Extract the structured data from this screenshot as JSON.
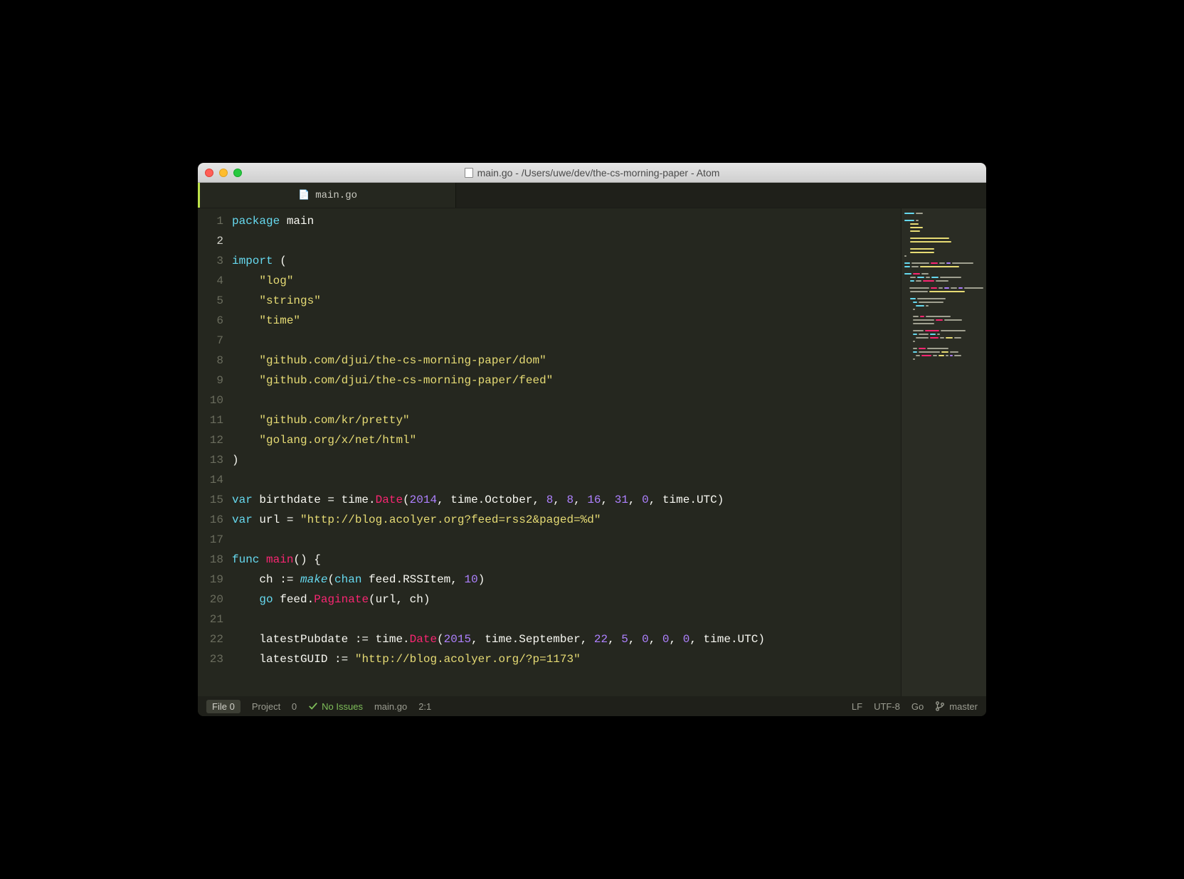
{
  "window": {
    "title": "main.go - /Users/uwe/dev/the-cs-morning-paper - Atom"
  },
  "tab": {
    "filename": "main.go",
    "icon": "file-code-icon",
    "modified": false
  },
  "editor": {
    "cursor_line": 2,
    "lines": [
      {
        "n": 1,
        "tokens": [
          {
            "t": "package ",
            "c": "kw"
          },
          {
            "t": "main",
            "c": "pkg"
          }
        ]
      },
      {
        "n": 2,
        "tokens": []
      },
      {
        "n": 3,
        "tokens": [
          {
            "t": "import ",
            "c": "kw"
          },
          {
            "t": "(",
            "c": "id"
          }
        ]
      },
      {
        "n": 4,
        "tokens": [
          {
            "t": "    ",
            "c": "id"
          },
          {
            "t": "\"log\"",
            "c": "str"
          }
        ]
      },
      {
        "n": 5,
        "tokens": [
          {
            "t": "    ",
            "c": "id"
          },
          {
            "t": "\"strings\"",
            "c": "str"
          }
        ]
      },
      {
        "n": 6,
        "tokens": [
          {
            "t": "    ",
            "c": "id"
          },
          {
            "t": "\"time\"",
            "c": "str"
          }
        ]
      },
      {
        "n": 7,
        "tokens": []
      },
      {
        "n": 8,
        "tokens": [
          {
            "t": "    ",
            "c": "id"
          },
          {
            "t": "\"github.com/djui/the-cs-morning-paper/dom\"",
            "c": "str"
          }
        ]
      },
      {
        "n": 9,
        "tokens": [
          {
            "t": "    ",
            "c": "id"
          },
          {
            "t": "\"github.com/djui/the-cs-morning-paper/feed\"",
            "c": "str"
          }
        ]
      },
      {
        "n": 10,
        "tokens": []
      },
      {
        "n": 11,
        "tokens": [
          {
            "t": "    ",
            "c": "id"
          },
          {
            "t": "\"github.com/kr/pretty\"",
            "c": "str"
          }
        ]
      },
      {
        "n": 12,
        "tokens": [
          {
            "t": "    ",
            "c": "id"
          },
          {
            "t": "\"golang.org/x/net/html\"",
            "c": "str"
          }
        ]
      },
      {
        "n": 13,
        "tokens": [
          {
            "t": ")",
            "c": "id"
          }
        ]
      },
      {
        "n": 14,
        "tokens": []
      },
      {
        "n": 15,
        "tokens": [
          {
            "t": "var ",
            "c": "kw"
          },
          {
            "t": "birthdate ",
            "c": "id"
          },
          {
            "t": "= ",
            "c": "id"
          },
          {
            "t": "time",
            "c": "id"
          },
          {
            "t": ".",
            "c": "id"
          },
          {
            "t": "Date",
            "c": "fn"
          },
          {
            "t": "(",
            "c": "id"
          },
          {
            "t": "2014",
            "c": "num"
          },
          {
            "t": ", time.October, ",
            "c": "id"
          },
          {
            "t": "8",
            "c": "num"
          },
          {
            "t": ", ",
            "c": "id"
          },
          {
            "t": "8",
            "c": "num"
          },
          {
            "t": ", ",
            "c": "id"
          },
          {
            "t": "16",
            "c": "num"
          },
          {
            "t": ", ",
            "c": "id"
          },
          {
            "t": "31",
            "c": "num"
          },
          {
            "t": ", ",
            "c": "id"
          },
          {
            "t": "0",
            "c": "num"
          },
          {
            "t": ", time.UTC)",
            "c": "id"
          }
        ]
      },
      {
        "n": 16,
        "tokens": [
          {
            "t": "var ",
            "c": "kw"
          },
          {
            "t": "url ",
            "c": "id"
          },
          {
            "t": "= ",
            "c": "id"
          },
          {
            "t": "\"http://blog.acolyer.org?feed=rss2&paged=%d\"",
            "c": "str"
          }
        ]
      },
      {
        "n": 17,
        "tokens": []
      },
      {
        "n": 18,
        "tokens": [
          {
            "t": "func ",
            "c": "kw"
          },
          {
            "t": "main",
            "c": "fn"
          },
          {
            "t": "() {",
            "c": "id"
          }
        ]
      },
      {
        "n": 19,
        "tokens": [
          {
            "t": "    ch ",
            "c": "id"
          },
          {
            "t": ":=",
            "c": "id"
          },
          {
            "t": " ",
            "c": "id"
          },
          {
            "t": "make",
            "c": "bi"
          },
          {
            "t": "(",
            "c": "id"
          },
          {
            "t": "chan ",
            "c": "kw"
          },
          {
            "t": "feed.RSSItem, ",
            "c": "id"
          },
          {
            "t": "10",
            "c": "num"
          },
          {
            "t": ")",
            "c": "id"
          }
        ]
      },
      {
        "n": 20,
        "tokens": [
          {
            "t": "    ",
            "c": "id"
          },
          {
            "t": "go ",
            "c": "kw"
          },
          {
            "t": "feed.",
            "c": "id"
          },
          {
            "t": "Paginate",
            "c": "fn"
          },
          {
            "t": "(url, ch)",
            "c": "id"
          }
        ]
      },
      {
        "n": 21,
        "tokens": []
      },
      {
        "n": 22,
        "tokens": [
          {
            "t": "    latestPubdate ",
            "c": "id"
          },
          {
            "t": ":=",
            "c": "id"
          },
          {
            "t": " time.",
            "c": "id"
          },
          {
            "t": "Date",
            "c": "fn"
          },
          {
            "t": "(",
            "c": "id"
          },
          {
            "t": "2015",
            "c": "num"
          },
          {
            "t": ", time.September, ",
            "c": "id"
          },
          {
            "t": "22",
            "c": "num"
          },
          {
            "t": ", ",
            "c": "id"
          },
          {
            "t": "5",
            "c": "num"
          },
          {
            "t": ", ",
            "c": "id"
          },
          {
            "t": "0",
            "c": "num"
          },
          {
            "t": ", ",
            "c": "id"
          },
          {
            "t": "0",
            "c": "num"
          },
          {
            "t": ", ",
            "c": "id"
          },
          {
            "t": "0",
            "c": "num"
          },
          {
            "t": ", time.UTC)",
            "c": "id"
          }
        ]
      },
      {
        "n": 23,
        "tokens": [
          {
            "t": "    latestGUID ",
            "c": "id"
          },
          {
            "t": ":=",
            "c": "id"
          },
          {
            "t": " ",
            "c": "id"
          },
          {
            "t": "\"http://blog.acolyer.org/?p=1173\"",
            "c": "str"
          }
        ]
      }
    ]
  },
  "statusbar": {
    "file_label": "File",
    "file_count": "0",
    "project_label": "Project",
    "project_count": "0",
    "issues": "No Issues",
    "path": "main.go",
    "cursor": "2:1",
    "eol": "LF",
    "encoding": "UTF-8",
    "language": "Go",
    "branch": "master"
  },
  "colors": {
    "minimap": [
      [
        [
          "#66d9ef",
          14
        ],
        [
          "#a0a090",
          10
        ]
      ],
      [],
      [
        [
          "#66d9ef",
          14
        ],
        [
          "#a0a090",
          4
        ]
      ],
      [
        [
          "",
          6
        ],
        [
          "#e6db74",
          12
        ]
      ],
      [
        [
          "",
          6
        ],
        [
          "#e6db74",
          18
        ]
      ],
      [
        [
          "",
          6
        ],
        [
          "#e6db74",
          14
        ]
      ],
      [],
      [
        [
          "",
          6
        ],
        [
          "#e6db74",
          55
        ]
      ],
      [
        [
          "",
          6
        ],
        [
          "#e6db74",
          58
        ]
      ],
      [],
      [
        [
          "",
          6
        ],
        [
          "#e6db74",
          34
        ]
      ],
      [
        [
          "",
          6
        ],
        [
          "#e6db74",
          34
        ]
      ],
      [
        [
          "#a0a090",
          3
        ]
      ],
      [],
      [
        [
          "#66d9ef",
          8
        ],
        [
          "#a0a090",
          25
        ],
        [
          "#f92672",
          10
        ],
        [
          "#a0a090",
          8
        ],
        [
          "#ae81ff",
          6
        ],
        [
          "#a0a090",
          30
        ]
      ],
      [
        [
          "#66d9ef",
          8
        ],
        [
          "#a0a090",
          10
        ],
        [
          "#e6db74",
          55
        ]
      ],
      [],
      [
        [
          "#66d9ef",
          10
        ],
        [
          "#f92672",
          10
        ],
        [
          "#a0a090",
          10
        ]
      ],
      [
        [
          "",
          6
        ],
        [
          "#a0a090",
          8
        ],
        [
          "#66d9ef",
          10
        ],
        [
          "#a0a090",
          6
        ],
        [
          "#66d9ef",
          10
        ],
        [
          "#a0a090",
          30
        ]
      ],
      [
        [
          "",
          6
        ],
        [
          "#66d9ef",
          6
        ],
        [
          "#a0a090",
          8
        ],
        [
          "#f92672",
          16
        ],
        [
          "#a0a090",
          18
        ]
      ],
      [],
      [
        [
          "",
          6
        ],
        [
          "#a0a090",
          30
        ],
        [
          "#f92672",
          10
        ],
        [
          "#a0a090",
          6
        ],
        [
          "#ae81ff",
          8
        ],
        [
          "#a0a090",
          10
        ],
        [
          "#ae81ff",
          6
        ],
        [
          "#a0a090",
          30
        ]
      ],
      [
        [
          "",
          6
        ],
        [
          "#a0a090",
          25
        ],
        [
          "#e6db74",
          50
        ]
      ],
      [],
      [
        [
          "",
          6
        ],
        [
          "#66d9ef",
          8
        ],
        [
          "#a0a090",
          40
        ]
      ],
      [
        [
          "",
          10
        ],
        [
          "#66d9ef",
          6
        ],
        [
          "#a0a090",
          35
        ]
      ],
      [
        [
          "",
          14
        ],
        [
          "#66d9ef",
          12
        ],
        [
          "#a0a090",
          4
        ]
      ],
      [
        [
          "",
          10
        ],
        [
          "#a0a090",
          3
        ]
      ],
      [],
      [
        [
          "",
          10
        ],
        [
          "#a0a090",
          8
        ],
        [
          "#f92672",
          6
        ],
        [
          "#a0a090",
          35
        ]
      ],
      [
        [
          "",
          10
        ],
        [
          "#a0a090",
          30
        ],
        [
          "#f92672",
          10
        ],
        [
          "#a0a090",
          25
        ]
      ],
      [
        [
          "",
          10
        ],
        [
          "#a0a090",
          30
        ]
      ],
      [],
      [
        [
          "",
          10
        ],
        [
          "#a0a090",
          15
        ],
        [
          "#f92672",
          20
        ],
        [
          "#a0a090",
          35
        ]
      ],
      [
        [
          "",
          10
        ],
        [
          "#66d9ef",
          6
        ],
        [
          "#a0a090",
          14
        ],
        [
          "#66d9ef",
          8
        ],
        [
          "#a0a090",
          4
        ]
      ],
      [
        [
          "",
          14
        ],
        [
          "#a0a090",
          18
        ],
        [
          "#f92672",
          12
        ],
        [
          "#a0a090",
          6
        ],
        [
          "#e6db74",
          10
        ],
        [
          "#a0a090",
          10
        ]
      ],
      [
        [
          "",
          10
        ],
        [
          "#a0a090",
          3
        ]
      ],
      [],
      [
        [
          "",
          10
        ],
        [
          "#a0a090",
          6
        ],
        [
          "#f92672",
          10
        ],
        [
          "#a0a090",
          30
        ]
      ],
      [
        [
          "",
          10
        ],
        [
          "#66d9ef",
          6
        ],
        [
          "#a0a090",
          30
        ],
        [
          "#e6db74",
          10
        ],
        [
          "#a0a090",
          12
        ]
      ],
      [
        [
          "",
          14
        ],
        [
          "#a0a090",
          6
        ],
        [
          "#f92672",
          14
        ],
        [
          "#a0a090",
          6
        ],
        [
          "#e6db74",
          8
        ],
        [
          "#a0a090",
          4
        ],
        [
          "#ae81ff",
          4
        ],
        [
          "#a0a090",
          10
        ]
      ],
      [
        [
          "",
          10
        ],
        [
          "#a0a090",
          3
        ]
      ]
    ]
  }
}
